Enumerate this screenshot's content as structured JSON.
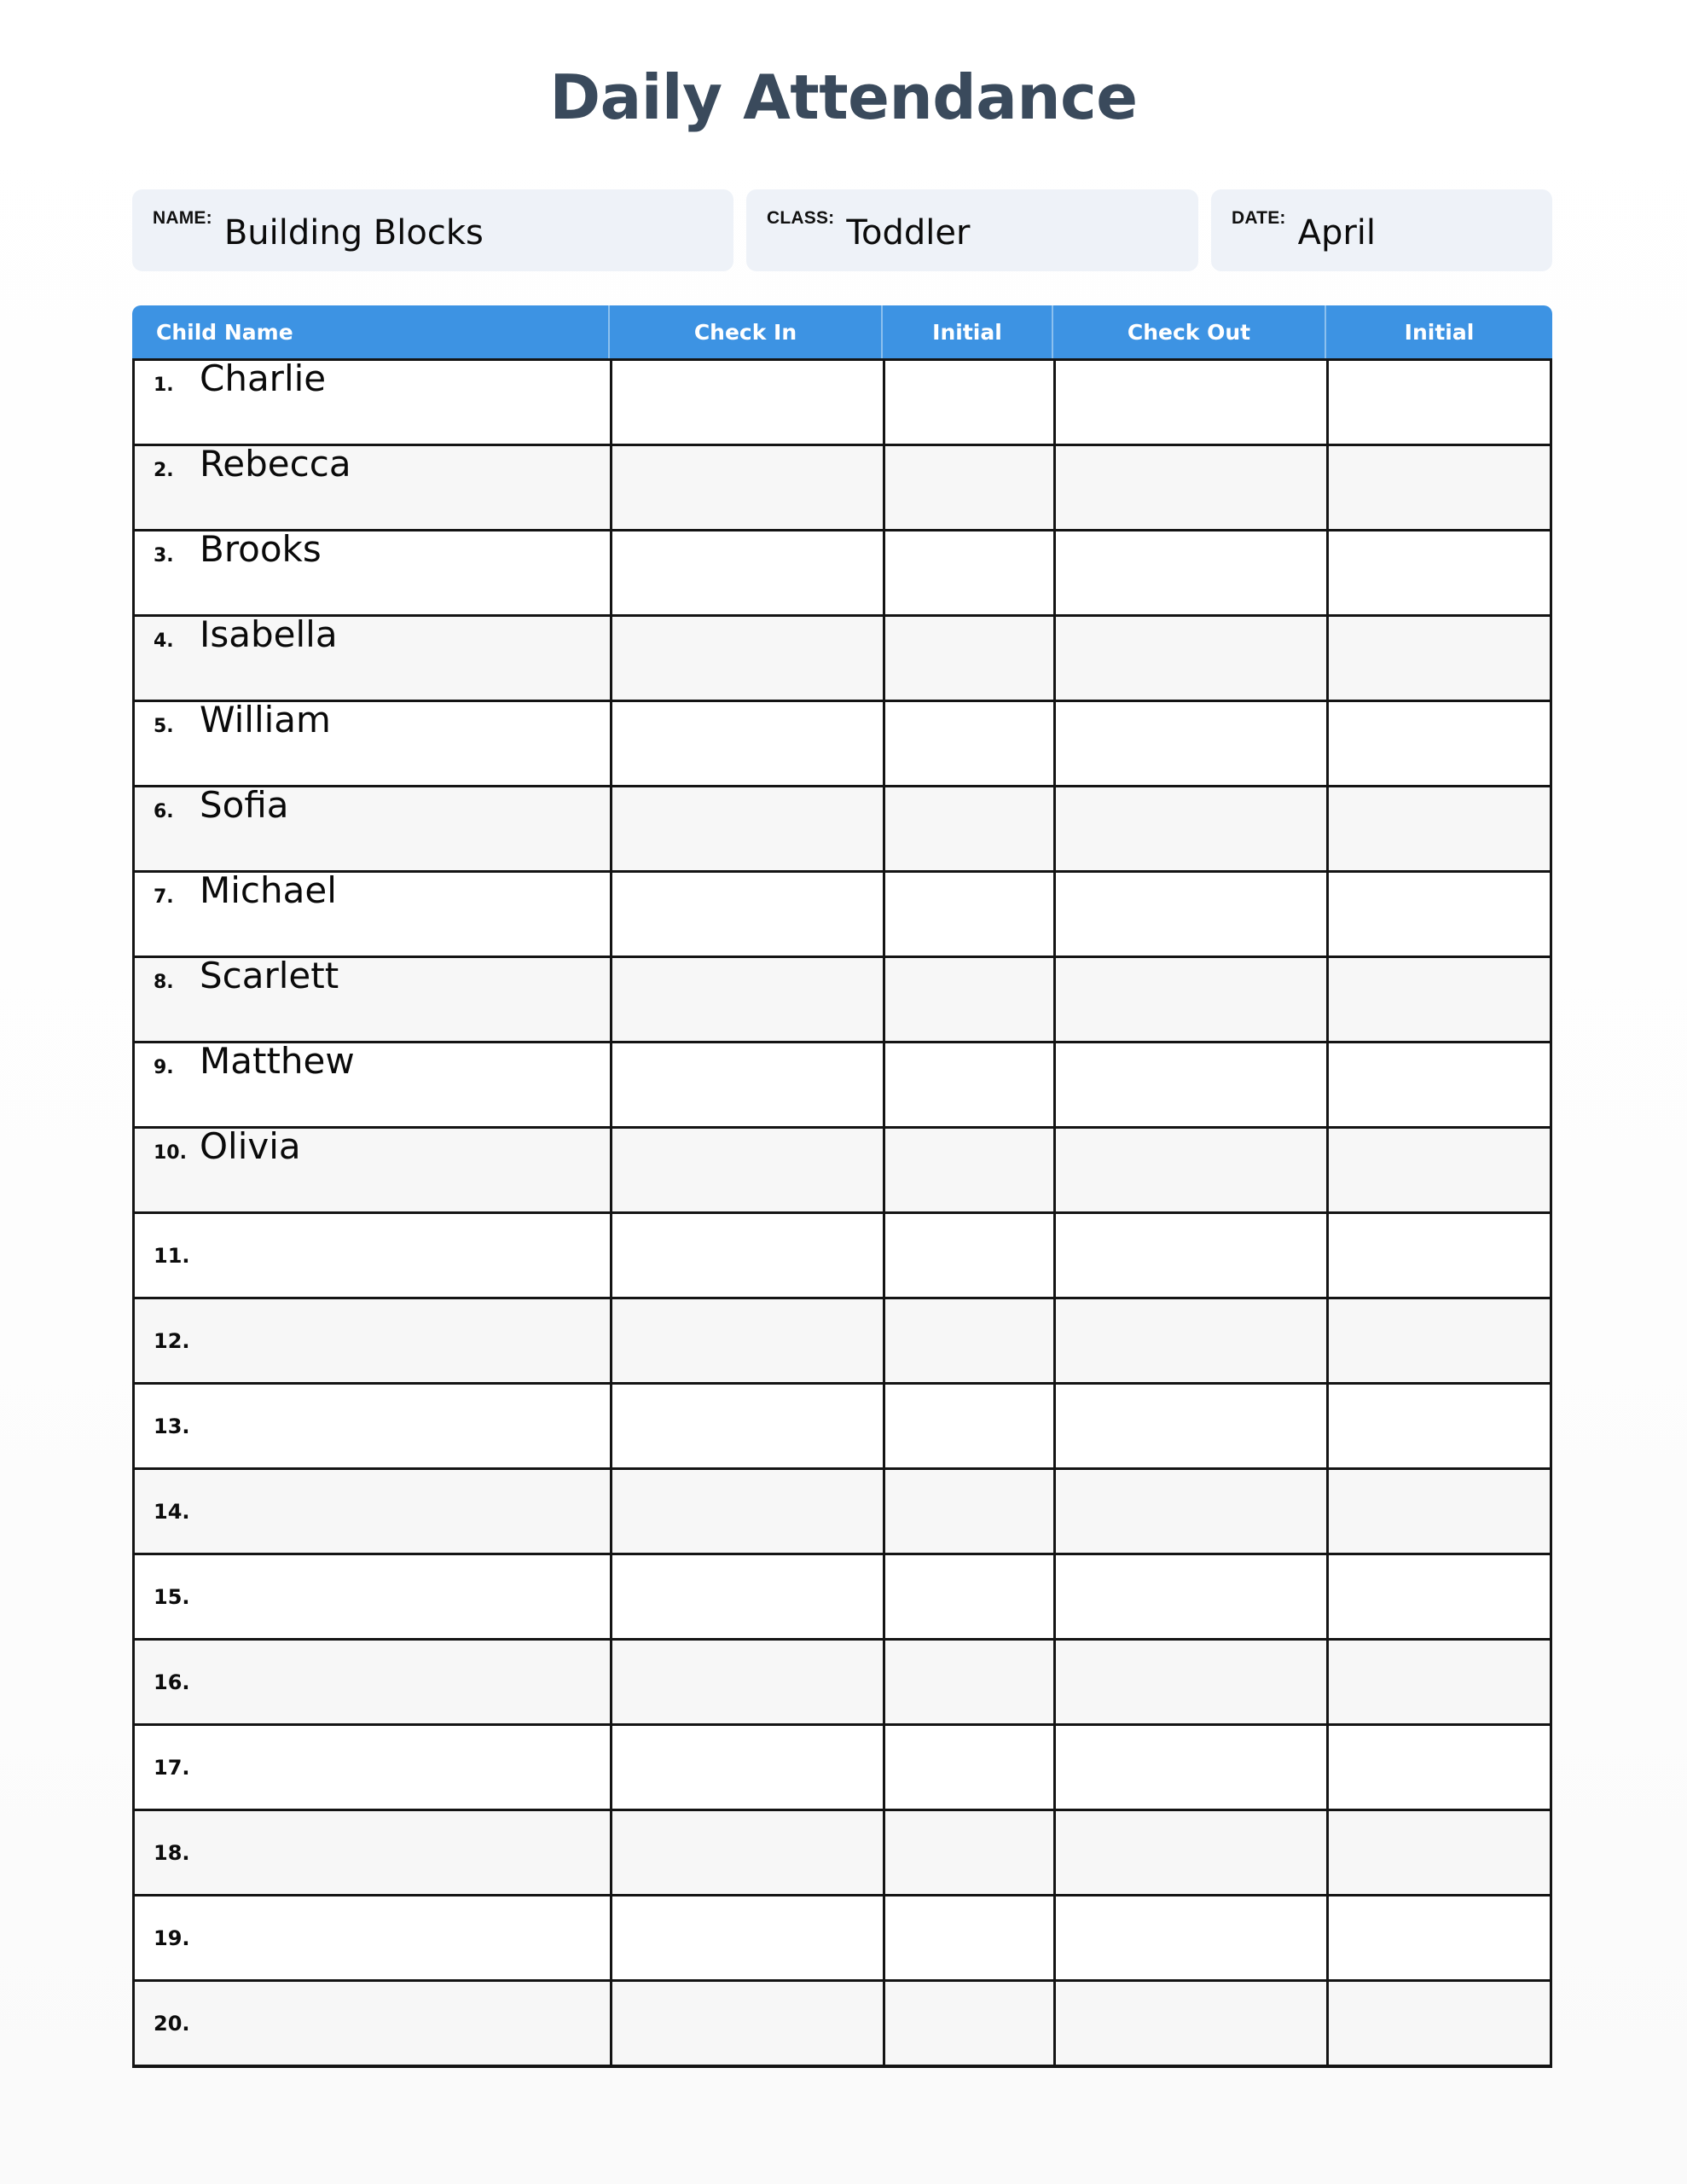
{
  "page": {
    "title": "Daily Attendance",
    "accent_color": "#3d93e3",
    "title_color": "#3a4a5c",
    "info_box_bg": "#eef2f8",
    "alt_row_bg": "#f7f7f7"
  },
  "info": {
    "name": {
      "label": "NAME:",
      "value": "Building Blocks"
    },
    "class": {
      "label": "CLASS:",
      "value": "Toddler"
    },
    "date": {
      "label": "DATE:",
      "value": "April"
    }
  },
  "table": {
    "columns": [
      {
        "key": "child_name",
        "label": "Child Name",
        "align": "left"
      },
      {
        "key": "check_in",
        "label": "Check In",
        "align": "center"
      },
      {
        "key": "initial_in",
        "label": "Initial",
        "align": "center"
      },
      {
        "key": "check_out",
        "label": "Check Out",
        "align": "center"
      },
      {
        "key": "initial_out",
        "label": "Initial",
        "align": "center"
      }
    ],
    "rows": [
      {
        "num": "1.",
        "child_name": "Charlie",
        "check_in": "",
        "initial_in": "",
        "check_out": "",
        "initial_out": ""
      },
      {
        "num": "2.",
        "child_name": "Rebecca",
        "check_in": "",
        "initial_in": "",
        "check_out": "",
        "initial_out": ""
      },
      {
        "num": "3.",
        "child_name": "Brooks",
        "check_in": "",
        "initial_in": "",
        "check_out": "",
        "initial_out": ""
      },
      {
        "num": "4.",
        "child_name": "Isabella",
        "check_in": "",
        "initial_in": "",
        "check_out": "",
        "initial_out": ""
      },
      {
        "num": "5.",
        "child_name": "William",
        "check_in": "",
        "initial_in": "",
        "check_out": "",
        "initial_out": ""
      },
      {
        "num": "6.",
        "child_name": "Sofia",
        "check_in": "",
        "initial_in": "",
        "check_out": "",
        "initial_out": ""
      },
      {
        "num": "7.",
        "child_name": "Michael",
        "check_in": "",
        "initial_in": "",
        "check_out": "",
        "initial_out": ""
      },
      {
        "num": "8.",
        "child_name": "Scarlett",
        "check_in": "",
        "initial_in": "",
        "check_out": "",
        "initial_out": ""
      },
      {
        "num": "9.",
        "child_name": "Matthew",
        "check_in": "",
        "initial_in": "",
        "check_out": "",
        "initial_out": ""
      },
      {
        "num": "10.",
        "child_name": "Olivia",
        "check_in": "",
        "initial_in": "",
        "check_out": "",
        "initial_out": ""
      },
      {
        "num": "11.",
        "child_name": "",
        "check_in": "",
        "initial_in": "",
        "check_out": "",
        "initial_out": ""
      },
      {
        "num": "12.",
        "child_name": "",
        "check_in": "",
        "initial_in": "",
        "check_out": "",
        "initial_out": ""
      },
      {
        "num": "13.",
        "child_name": "",
        "check_in": "",
        "initial_in": "",
        "check_out": "",
        "initial_out": ""
      },
      {
        "num": "14.",
        "child_name": "",
        "check_in": "",
        "initial_in": "",
        "check_out": "",
        "initial_out": ""
      },
      {
        "num": "15.",
        "child_name": "",
        "check_in": "",
        "initial_in": "",
        "check_out": "",
        "initial_out": ""
      },
      {
        "num": "16.",
        "child_name": "",
        "check_in": "",
        "initial_in": "",
        "check_out": "",
        "initial_out": ""
      },
      {
        "num": "17.",
        "child_name": "",
        "check_in": "",
        "initial_in": "",
        "check_out": "",
        "initial_out": ""
      },
      {
        "num": "18.",
        "child_name": "",
        "check_in": "",
        "initial_in": "",
        "check_out": "",
        "initial_out": ""
      },
      {
        "num": "19.",
        "child_name": "",
        "check_in": "",
        "initial_in": "",
        "check_out": "",
        "initial_out": ""
      },
      {
        "num": "20.",
        "child_name": "",
        "check_in": "",
        "initial_in": "",
        "check_out": "",
        "initial_out": ""
      }
    ]
  }
}
